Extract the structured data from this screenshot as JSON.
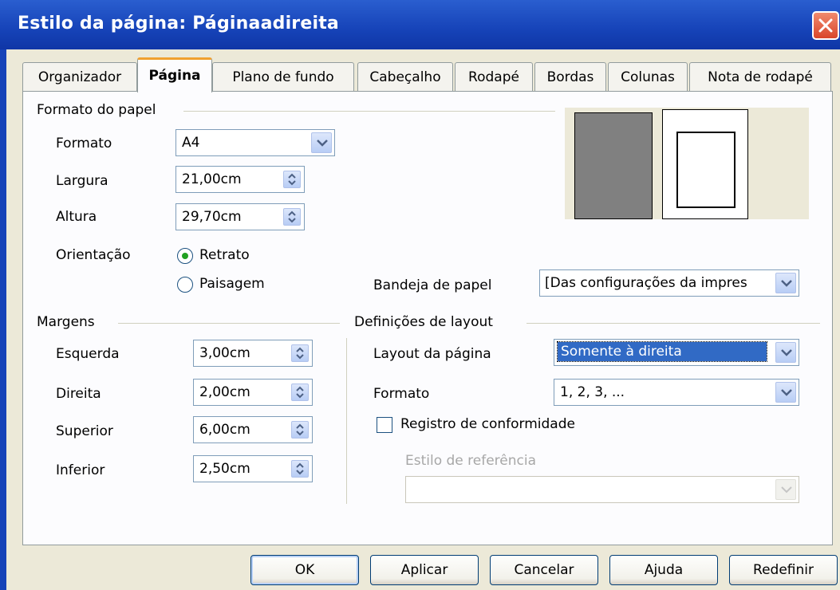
{
  "window": {
    "title": "Estilo da página: Páginaadireita"
  },
  "tabs": [
    "Organizador",
    "Página",
    "Plano de fundo",
    "Cabeçalho",
    "Rodapé",
    "Bordas",
    "Colunas",
    "Nota de rodapé"
  ],
  "paper_format": {
    "group_label": "Formato do papel",
    "format_label": "Formato",
    "format_value": "A4",
    "width_label": "Largura",
    "width_value": "21,00cm",
    "height_label": "Altura",
    "height_value": "29,70cm",
    "orientation_label": "Orientação",
    "portrait_label": "Retrato",
    "landscape_label": "Paisagem",
    "portrait_selected": true,
    "tray_label": "Bandeja de papel",
    "tray_value": "[Das configurações da impres"
  },
  "margins": {
    "group_label": "Margens",
    "left_label": "Esquerda",
    "left_value": "3,00cm",
    "right_label": "Direita",
    "right_value": "2,00cm",
    "top_label": "Superior",
    "top_value": "6,00cm",
    "bottom_label": "Inferior",
    "bottom_value": "2,50cm"
  },
  "layout": {
    "group_label": "Definições de layout",
    "page_layout_label": "Layout da página",
    "page_layout_value": "Somente à direita",
    "format_label": "Formato",
    "format_value": "1, 2, 3, ...",
    "register_label": "Registro de conformidade",
    "register_checked": false,
    "reference_style_label": "Estilo de referência",
    "reference_style_value": ""
  },
  "buttons": {
    "ok": "OK",
    "apply": "Aplicar",
    "cancel": "Cancelar",
    "help": "Ajuda",
    "reset": "Redefinir"
  },
  "colors": {
    "title_bar": "#1643b8",
    "selection": "#316ac5",
    "active_tab_accent": "#f0a030",
    "dialog_bg": "#ece9d8"
  }
}
